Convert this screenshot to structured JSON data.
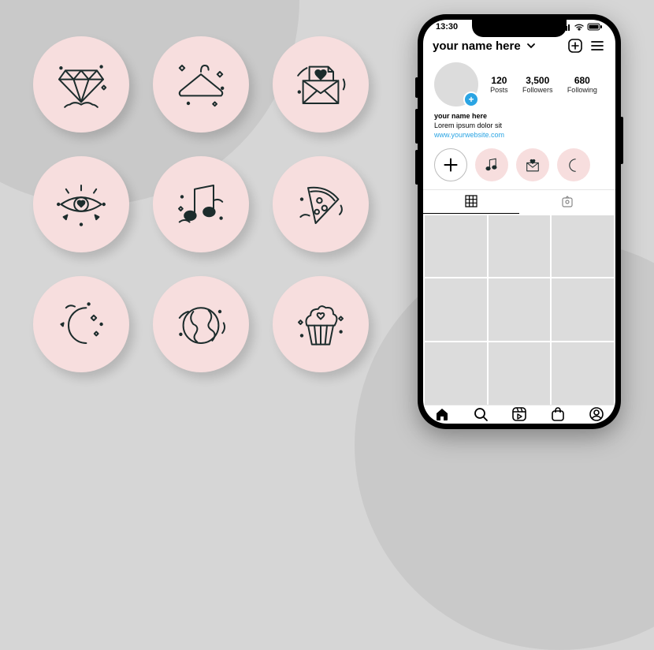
{
  "status": {
    "time": "13:30"
  },
  "header": {
    "username": "your name here"
  },
  "stats": {
    "posts_n": "120",
    "posts_l": "Posts",
    "followers_n": "3,500",
    "followers_l": "Followers",
    "following_n": "680",
    "following_l": "Following"
  },
  "bio": {
    "name": "your name here",
    "text": "Lorem ipsum dolor sit",
    "link": "www.yourwebsite.com"
  },
  "highlights_big": [
    "diamond-icon",
    "hanger-icon",
    "love-letter-icon",
    "eye-icon",
    "music-note-icon",
    "pizza-icon",
    "moon-icon",
    "globe-icon",
    "cupcake-icon"
  ],
  "highlights_small": [
    "new",
    "music-note-icon",
    "love-letter-icon",
    "moon-icon"
  ]
}
